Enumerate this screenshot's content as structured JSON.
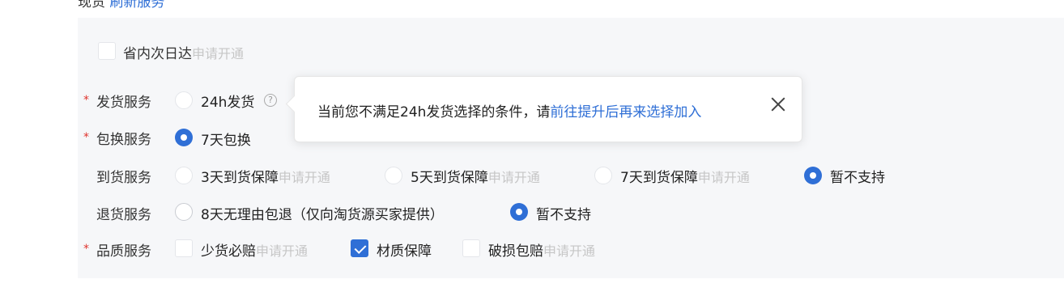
{
  "header": {
    "prefix": "现货",
    "link": "刷新服务"
  },
  "apply_label": "申请开通",
  "rows": {
    "province": {
      "option": "省内次日达"
    },
    "delivery": {
      "label": "发货服务",
      "option": "24h发货",
      "help": "?",
      "tooltip": {
        "text": "当前您不满足24h发货选择的条件，请",
        "link": "前往提升后再来选择加入"
      }
    },
    "exchange": {
      "label": "包换服务",
      "option": "7天包换"
    },
    "arrival": {
      "label": "到货服务",
      "options": [
        "3天到货保障",
        "5天到货保障",
        "7天到货保障",
        "暂不支持"
      ]
    },
    "return": {
      "label": "退货服务",
      "options": [
        "8天无理由包退（仅向淘货源买家提供）",
        "暂不支持"
      ]
    },
    "quality": {
      "label": "品质服务",
      "options": [
        "少货必赔",
        "材质保障",
        "破损包赔"
      ]
    }
  },
  "required_mark": "*",
  "colors": {
    "accent": "#2f6fd6",
    "required": "#e0332d",
    "panel_bg": "#f6f7f9"
  }
}
